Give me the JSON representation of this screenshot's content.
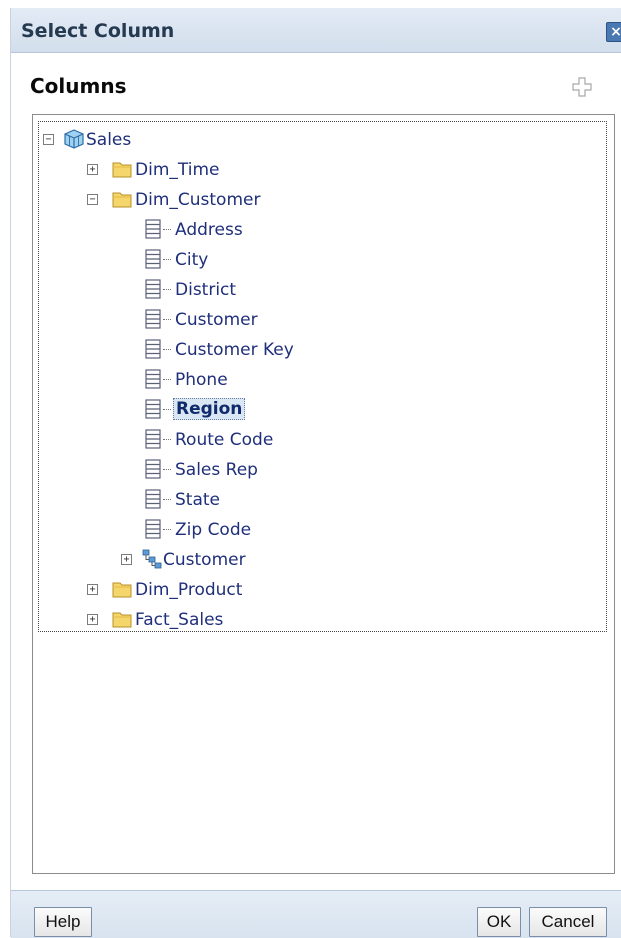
{
  "dialog": {
    "title": "Select Column",
    "close_icon": "close-icon",
    "section_title": "Columns",
    "add_icon": "plus-icon"
  },
  "tree": {
    "root": {
      "label": "Sales",
      "icon": "cube-icon",
      "expanded": true
    },
    "folders": [
      {
        "label": "Dim_Time",
        "expanded": false
      },
      {
        "label": "Dim_Customer",
        "expanded": true
      },
      {
        "label": "Dim_Product",
        "expanded": false
      },
      {
        "label": "Fact_Sales",
        "expanded": false
      }
    ],
    "customer_columns": [
      {
        "label": "Address"
      },
      {
        "label": "City"
      },
      {
        "label": "District"
      },
      {
        "label": "Customer"
      },
      {
        "label": "Customer Key"
      },
      {
        "label": "Phone"
      },
      {
        "label": "Region",
        "selected": true
      },
      {
        "label": "Route Code"
      },
      {
        "label": "Sales Rep"
      },
      {
        "label": "State"
      },
      {
        "label": "Zip Code"
      }
    ],
    "hierarchy": {
      "label": "Customer",
      "icon": "hierarchy-icon",
      "expanded": false
    }
  },
  "buttons": {
    "help": "Help",
    "ok": "OK",
    "cancel": "Cancel"
  },
  "colors": {
    "title_bar": "#d8e3ef",
    "tree_label": "#1f2f7a",
    "selection_bg": "#d9e6f4",
    "folder": "#f5d66b"
  }
}
